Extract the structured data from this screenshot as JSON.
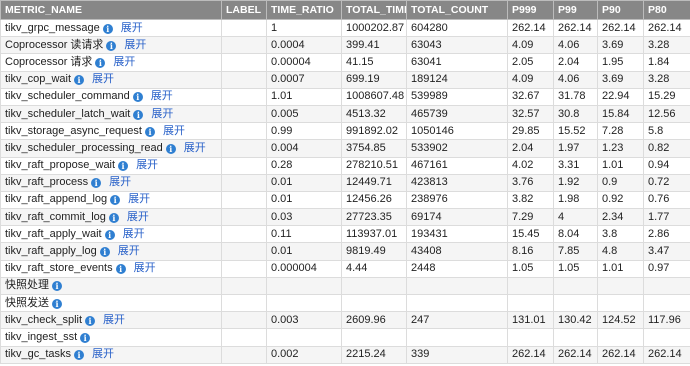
{
  "table": {
    "headers": [
      "METRIC_NAME",
      "LABEL",
      "TIME_RATIO",
      "TOTAL_TIME",
      "TOTAL_COUNT",
      "P999",
      "P99",
      "P90",
      "P80"
    ],
    "expand_label": "展开",
    "info_glyph": "i",
    "rows": [
      {
        "name": "tikv_grpc_message",
        "info": true,
        "expand": true,
        "label": "",
        "ratio": "1",
        "total_time": "1000202.87",
        "total_count": "604280",
        "p999": "262.14",
        "p99": "262.14",
        "p90": "262.14",
        "p80": "262.14"
      },
      {
        "name": "Coprocessor 读请求",
        "info": true,
        "expand": true,
        "label": "",
        "ratio": "0.0004",
        "total_time": "399.41",
        "total_count": "63043",
        "p999": "4.09",
        "p99": "4.06",
        "p90": "3.69",
        "p80": "3.28"
      },
      {
        "name": "Coprocessor 请求",
        "info": true,
        "expand": true,
        "label": "",
        "ratio": "0.00004",
        "total_time": "41.15",
        "total_count": "63041",
        "p999": "2.05",
        "p99": "2.04",
        "p90": "1.95",
        "p80": "1.84"
      },
      {
        "name": "tikv_cop_wait",
        "info": true,
        "expand": true,
        "label": "",
        "ratio": "0.0007",
        "total_time": "699.19",
        "total_count": "189124",
        "p999": "4.09",
        "p99": "4.06",
        "p90": "3.69",
        "p80": "3.28"
      },
      {
        "name": "tikv_scheduler_command",
        "info": true,
        "expand": true,
        "label": "",
        "ratio": "1.01",
        "total_time": "1008607.48",
        "total_count": "539989",
        "p999": "32.67",
        "p99": "31.78",
        "p90": "22.94",
        "p80": "15.29"
      },
      {
        "name": "tikv_scheduler_latch_wait",
        "info": true,
        "expand": true,
        "label": "",
        "ratio": "0.005",
        "total_time": "4513.32",
        "total_count": "465739",
        "p999": "32.57",
        "p99": "30.8",
        "p90": "15.84",
        "p80": "12.56"
      },
      {
        "name": "tikv_storage_async_request",
        "info": true,
        "expand": true,
        "label": "",
        "ratio": "0.99",
        "total_time": "991892.02",
        "total_count": "1050146",
        "p999": "29.85",
        "p99": "15.52",
        "p90": "7.28",
        "p80": "5.8"
      },
      {
        "name": "tikv_scheduler_processing_read",
        "info": true,
        "expand": true,
        "label": "",
        "ratio": "0.004",
        "total_time": "3754.85",
        "total_count": "533902",
        "p999": "2.04",
        "p99": "1.97",
        "p90": "1.23",
        "p80": "0.82"
      },
      {
        "name": "tikv_raft_propose_wait",
        "info": true,
        "expand": true,
        "label": "",
        "ratio": "0.28",
        "total_time": "278210.51",
        "total_count": "467161",
        "p999": "4.02",
        "p99": "3.31",
        "p90": "1.01",
        "p80": "0.94"
      },
      {
        "name": "tikv_raft_process",
        "info": true,
        "expand": true,
        "label": "",
        "ratio": "0.01",
        "total_time": "12449.71",
        "total_count": "423813",
        "p999": "3.76",
        "p99": "1.92",
        "p90": "0.9",
        "p80": "0.72"
      },
      {
        "name": "tikv_raft_append_log",
        "info": true,
        "expand": true,
        "label": "",
        "ratio": "0.01",
        "total_time": "12456.26",
        "total_count": "238976",
        "p999": "3.82",
        "p99": "1.98",
        "p90": "0.92",
        "p80": "0.76"
      },
      {
        "name": "tikv_raft_commit_log",
        "info": true,
        "expand": true,
        "label": "",
        "ratio": "0.03",
        "total_time": "27723.35",
        "total_count": "69174",
        "p999": "7.29",
        "p99": "4",
        "p90": "2.34",
        "p80": "1.77"
      },
      {
        "name": "tikv_raft_apply_wait",
        "info": true,
        "expand": true,
        "label": "",
        "ratio": "0.11",
        "total_time": "113937.01",
        "total_count": "193431",
        "p999": "15.45",
        "p99": "8.04",
        "p90": "3.8",
        "p80": "2.86"
      },
      {
        "name": "tikv_raft_apply_log",
        "info": true,
        "expand": true,
        "label": "",
        "ratio": "0.01",
        "total_time": "9819.49",
        "total_count": "43408",
        "p999": "8.16",
        "p99": "7.85",
        "p90": "4.8",
        "p80": "3.47"
      },
      {
        "name": "tikv_raft_store_events",
        "info": true,
        "expand": true,
        "label": "",
        "ratio": "0.000004",
        "total_time": "4.44",
        "total_count": "2448",
        "p999": "1.05",
        "p99": "1.05",
        "p90": "1.01",
        "p80": "0.97"
      },
      {
        "name": "快照处理",
        "info": true,
        "expand": false,
        "label": "",
        "ratio": "",
        "total_time": "",
        "total_count": "",
        "p999": "",
        "p99": "",
        "p90": "",
        "p80": ""
      },
      {
        "name": "快照发送",
        "info": true,
        "expand": false,
        "label": "",
        "ratio": "",
        "total_time": "",
        "total_count": "",
        "p999": "",
        "p99": "",
        "p90": "",
        "p80": ""
      },
      {
        "name": "tikv_check_split",
        "info": true,
        "expand": true,
        "label": "",
        "ratio": "0.003",
        "total_time": "2609.96",
        "total_count": "247",
        "p999": "131.01",
        "p99": "130.42",
        "p90": "124.52",
        "p80": "117.96"
      },
      {
        "name": "tikv_ingest_sst",
        "info": true,
        "expand": false,
        "label": "",
        "ratio": "",
        "total_time": "",
        "total_count": "",
        "p999": "",
        "p99": "",
        "p90": "",
        "p80": ""
      },
      {
        "name": "tikv_gc_tasks",
        "info": true,
        "expand": true,
        "label": "",
        "ratio": "0.002",
        "total_time": "2215.24",
        "total_count": "339",
        "p999": "262.14",
        "p99": "262.14",
        "p90": "262.14",
        "p80": "262.14"
      }
    ]
  }
}
